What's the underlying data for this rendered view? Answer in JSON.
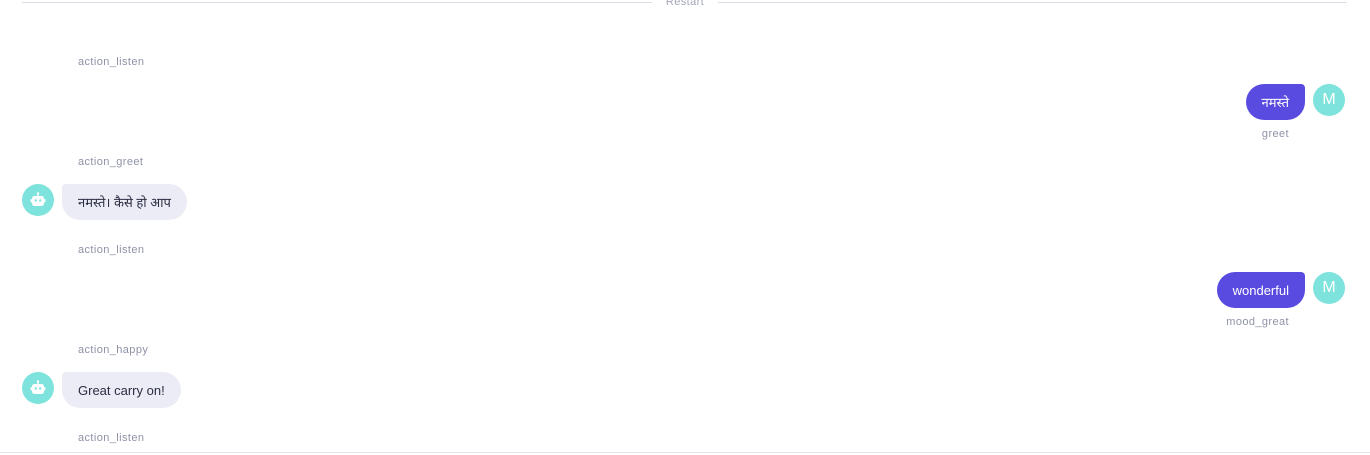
{
  "restart": {
    "label": "Restart"
  },
  "messages": [
    {
      "type": "action",
      "label": "action_listen"
    },
    {
      "type": "user",
      "text": "नमस्ते",
      "intent": "greet",
      "avatar": "M"
    },
    {
      "type": "action",
      "label": "action_greet"
    },
    {
      "type": "bot",
      "text": "नमस्ते। कैसे हो आप",
      "avatar_icon": "robot-icon"
    },
    {
      "type": "action",
      "label": "action_listen"
    },
    {
      "type": "user",
      "text": "wonderful",
      "intent": "mood_great",
      "avatar": "M"
    },
    {
      "type": "action",
      "label": "action_happy"
    },
    {
      "type": "bot",
      "text": "Great carry on!",
      "avatar_icon": "robot-icon"
    },
    {
      "type": "action",
      "label": "action_listen"
    }
  ],
  "colors": {
    "user_bubble": "#5a4be0",
    "bot_bubble": "#ebecf5",
    "avatar": "#7ee3dc",
    "muted_text": "#8f93a6"
  }
}
